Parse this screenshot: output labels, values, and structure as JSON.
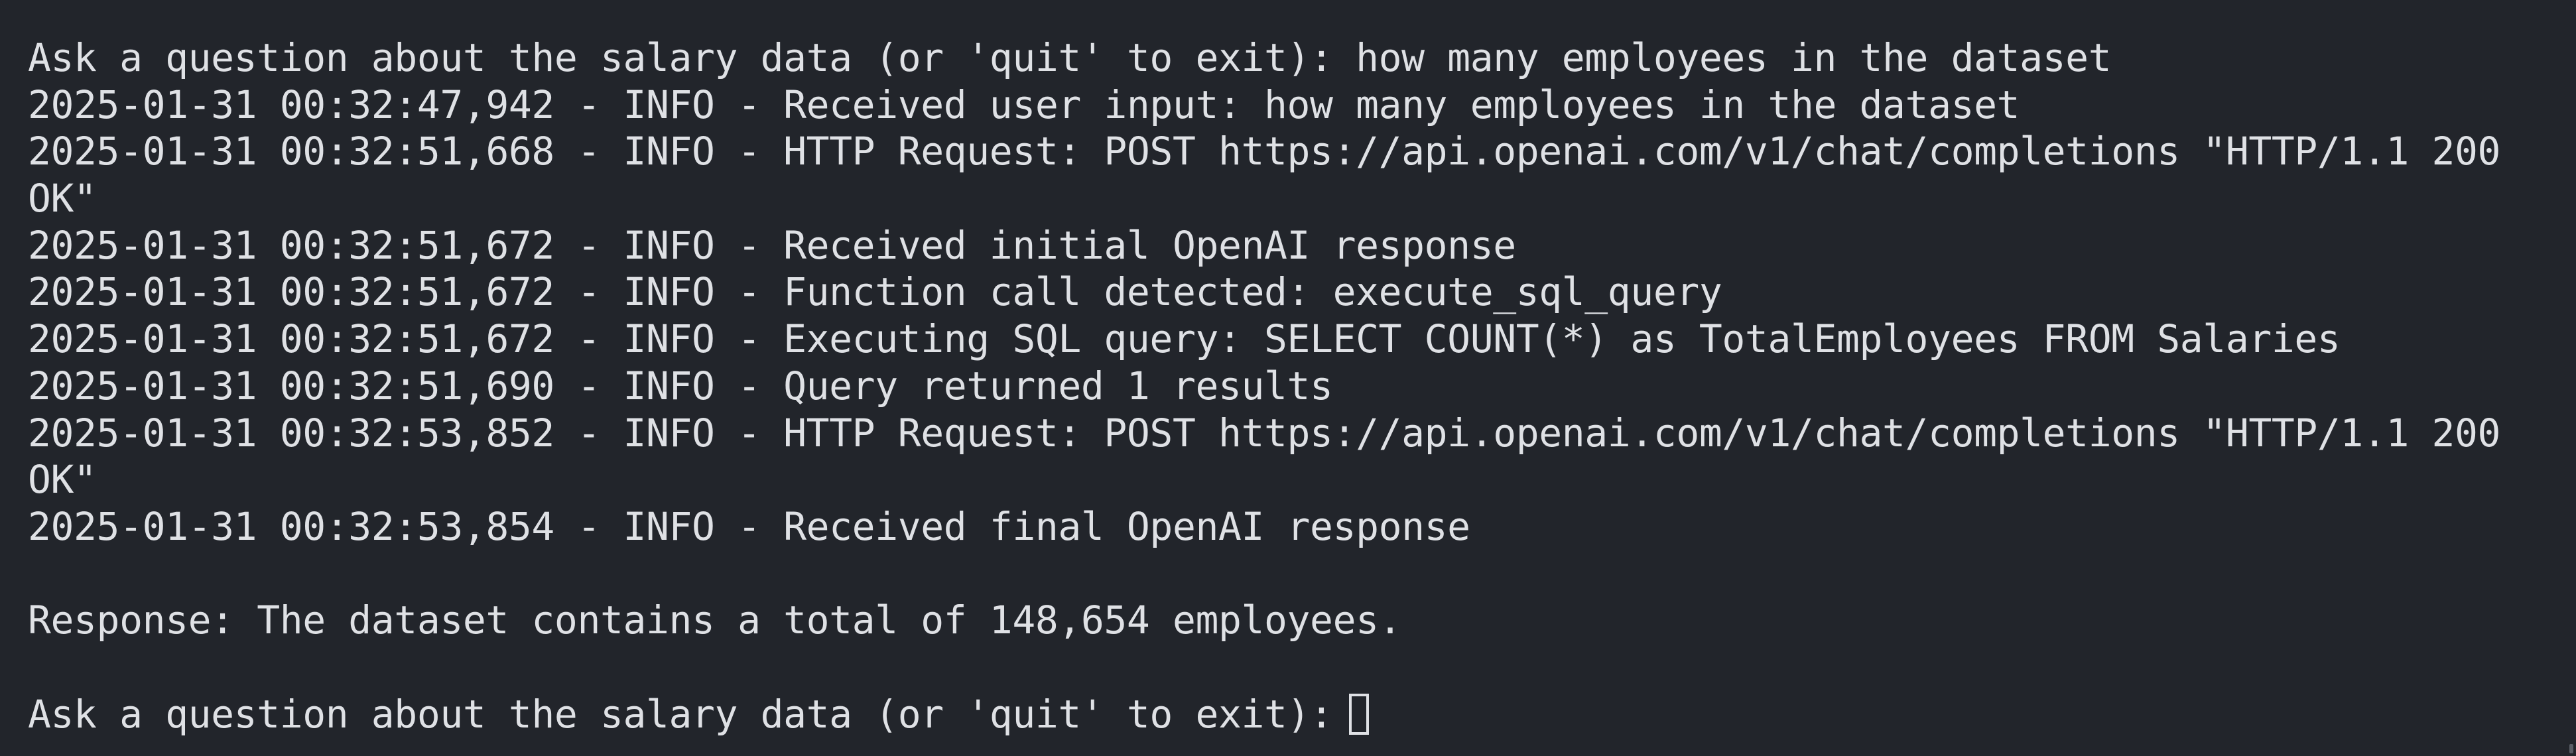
{
  "terminal": {
    "lines": [
      "Ask a question about the salary data (or 'quit' to exit): how many employees in the dataset",
      "2025-01-31 00:32:47,942 - INFO - Received user input: how many employees in the dataset",
      "2025-01-31 00:32:51,668 - INFO - HTTP Request: POST https://api.openai.com/v1/chat/completions \"HTTP/1.1 200",
      "OK\"",
      "2025-01-31 00:32:51,672 - INFO - Received initial OpenAI response",
      "2025-01-31 00:32:51,672 - INFO - Function call detected: execute_sql_query",
      "2025-01-31 00:32:51,672 - INFO - Executing SQL query: SELECT COUNT(*) as TotalEmployees FROM Salaries",
      "2025-01-31 00:32:51,690 - INFO - Query returned 1 results",
      "2025-01-31 00:32:53,852 - INFO - HTTP Request: POST https://api.openai.com/v1/chat/completions \"HTTP/1.1 200",
      "OK\"",
      "2025-01-31 00:32:53,854 - INFO - Received final OpenAI response",
      "",
      "Response: The dataset contains a total of 148,654 employees.",
      ""
    ],
    "prompt": "Ask a question about the salary data (or 'quit' to exit):"
  },
  "colors": {
    "background": "#22252b",
    "foreground": "#dfe1e5"
  }
}
